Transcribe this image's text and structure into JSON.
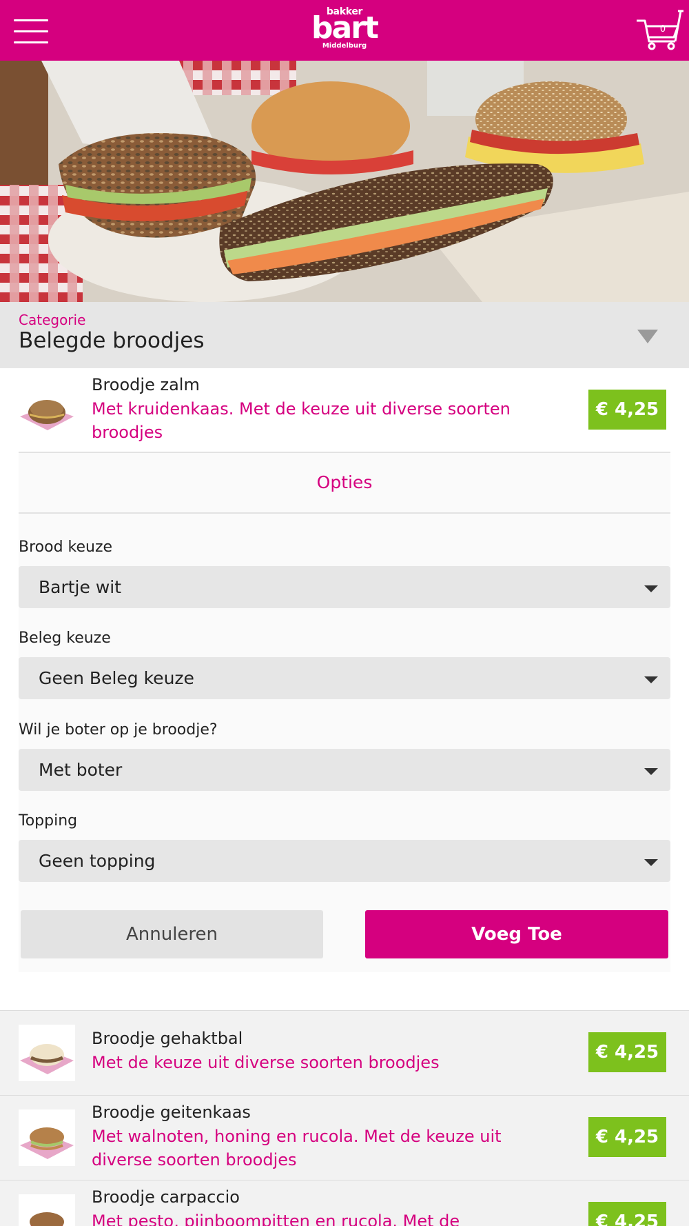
{
  "header": {
    "logo_top": "bakker",
    "logo_main": "bart",
    "logo_sub": "Middelburg",
    "cart_count": "0",
    "accent_color": "#d5007f"
  },
  "category": {
    "label": "Categorie",
    "value": "Belegde broodjes"
  },
  "expanded_product": {
    "name": "Broodje zalm",
    "description": "Met kruidenkaas. Met de keuze uit diverse soorten broodjes",
    "price": "€ 4,25",
    "options_title": "Opties",
    "fields": [
      {
        "label": "Brood keuze",
        "value": "Bartje wit"
      },
      {
        "label": "Beleg keuze",
        "value": "Geen Beleg keuze"
      },
      {
        "label": "Wil je boter op je broodje?",
        "value": "Met boter"
      },
      {
        "label": "Topping",
        "value": "Geen topping"
      }
    ],
    "cancel_label": "Annuleren",
    "add_label": "Voeg Toe"
  },
  "products": [
    {
      "name": "Broodje gehaktbal",
      "description": "Met de keuze uit diverse soorten broodjes",
      "price": "€ 4,25"
    },
    {
      "name": "Broodje geitenkaas",
      "description": "Met walnoten, honing en rucola. Met de keuze uit diverse soorten broodjes",
      "price": "€ 4,25"
    },
    {
      "name": "Broodje carpaccio",
      "description": "Met pesto, pijnboompitten en rucola. Met de",
      "price": "€ 4,25"
    }
  ],
  "colors": {
    "brand": "#d5007f",
    "price": "#7dc11d",
    "select_bg": "#e6e6e6"
  },
  "icons": [
    "menu-icon",
    "cart-icon",
    "dropdown-caret-icon"
  ]
}
